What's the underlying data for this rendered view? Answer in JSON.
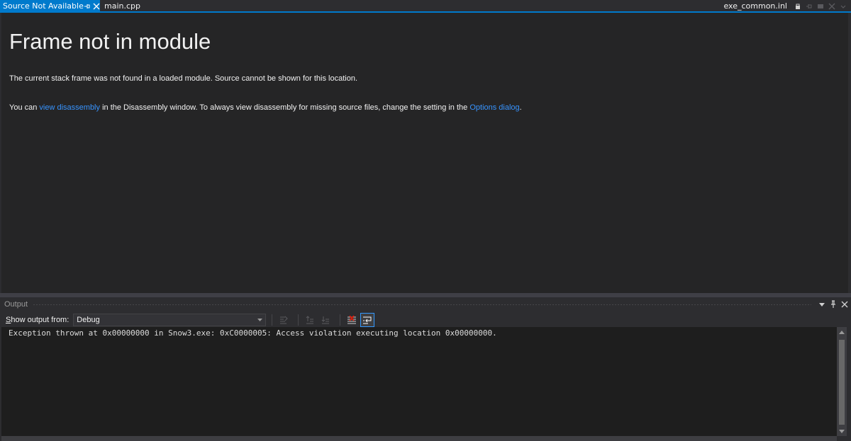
{
  "tabs": {
    "active_label": "Source Not Available",
    "second_label": "main.cpp",
    "right_label": "exe_common.inl"
  },
  "document": {
    "title": "Frame not in module",
    "line1": "The current stack frame was not found in a loaded module. Source cannot be shown for this location.",
    "line2_prefix": "You can ",
    "line2_link1": "view disassembly",
    "line2_middle": " in the Disassembly window. To always view disassembly for missing source files, change the setting in the ",
    "line2_link2": "Options dialog",
    "line2_suffix": "."
  },
  "output": {
    "title": "Output",
    "show_label_underlined": "S",
    "show_label_rest": "how output from:",
    "source_value": "Debug",
    "text": "Exception thrown at 0x00000000 in Snow3.exe: 0xC0000005: Access violation executing location 0x00000000."
  },
  "colors": {
    "accent": "#007acc",
    "link": "#3794ff",
    "doc_background": "#252526",
    "chrome_background": "#2d2d30",
    "output_background": "#1e1e1e"
  },
  "icons": {
    "tab_pin": "pin-icon",
    "tab_close": "close-icon",
    "panel_menu": "dropdown-arrow-icon",
    "panel_pin": "pin-icon",
    "panel_close": "close-icon",
    "find_in_code": "go-to-code-icon",
    "prev_message": "previous-message-icon",
    "next_message": "next-message-icon",
    "clear_all": "clear-all-icon",
    "word_wrap": "word-wrap-icon"
  }
}
